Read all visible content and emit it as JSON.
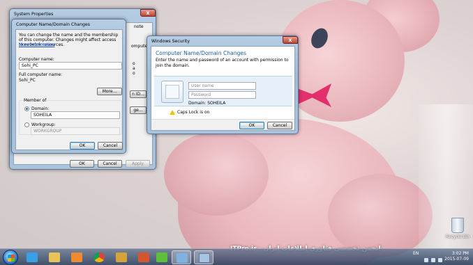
{
  "system_properties": {
    "title": "System Properties",
    "close_symbol": "x",
    "tab_fragment": "note",
    "side_fragments": [
      "omputer",
      "o",
      "a",
      "o",
      "n ID...",
      "ge..."
    ],
    "buttons": {
      "ok": "OK",
      "cancel": "Cancel",
      "apply": "Apply"
    }
  },
  "name_changes": {
    "title": "Computer Name/Domain Changes",
    "description": "You can change the name and the membership of this computer. Changes might affect access to network resources.",
    "more_info_link": "More information",
    "computer_name_label": "Computer name:",
    "computer_name_value": "Sohi_PC",
    "full_name_label": "Full computer name:",
    "full_name_value": "Sohi_PC",
    "more_button": "More...",
    "member_of_label": "Member of",
    "domain_label": "Domain:",
    "domain_value": "SOHEILA",
    "workgroup_label": "Workgroup:",
    "workgroup_value": "WORKGROUP",
    "ok": "OK",
    "cancel": "Cancel",
    "selected_membership": "domain"
  },
  "windows_security": {
    "title": "Windows Security",
    "close_symbol": "x",
    "heading": "Computer Name/Domain Changes",
    "instruction": "Enter the name and password of an account with permission to join the domain.",
    "username_placeholder": "User name",
    "password_placeholder": "Password",
    "domain_text": "Domain: SOHEILA",
    "warning_text": "Caps Lock is on",
    "warning_icon": "warning-icon",
    "ok": "OK",
    "cancel": "Cancel",
    "accent_color": "#1e5eb0"
  },
  "desktop": {
    "recycle_bin_label": "Recycle Bin",
    "watermark": "ITPro.ir - انجمن تخصصی فناوری اطلاعات ایران"
  },
  "taskbar": {
    "language": "EN",
    "time": "3:02 PM",
    "date": "2015-07-09",
    "items": [
      "ie-icon",
      "folder-icon",
      "media-player-icon",
      "explorer-icon",
      "powerpoint-icon",
      "chrome-icon",
      "app-icon",
      "excel-icon",
      "word-icon",
      "parrot-icon",
      "network-icon",
      "system-properties-icon"
    ]
  }
}
